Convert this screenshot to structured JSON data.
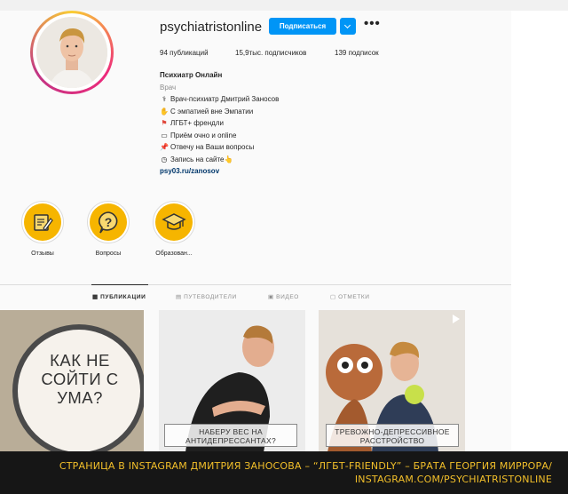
{
  "profile": {
    "username": "psychiatristonline",
    "follow_label": "Подписаться",
    "more_label": "•••",
    "stats": {
      "posts": "94 публикаций",
      "followers": "15,9тыс. подписчиков",
      "following": "139 подписок"
    },
    "bio": {
      "name": "Психиатр Онлайн",
      "category": "Врач",
      "lines": [
        {
          "icon": "doctor-icon",
          "glyph": "⚕",
          "text": "Врач-психиатр Дмитрий Заносов"
        },
        {
          "icon": "hands-icon",
          "glyph": "✋",
          "text": "С эмпатией вне Эмпатии"
        },
        {
          "icon": "rainbow-flag-icon",
          "glyph": "⚑",
          "text": "ЛГБТ+ френдли"
        },
        {
          "icon": "laptop-icon",
          "glyph": "▭",
          "text": "Приём очно и online"
        },
        {
          "icon": "pin-icon",
          "glyph": "📌",
          "text": "Отвечу на Ваши вопросы"
        },
        {
          "icon": "clock-icon",
          "glyph": "◷",
          "text": "Запись на сайте👆"
        }
      ],
      "link": "psy03.ru/zanosov"
    }
  },
  "highlights": [
    {
      "label": "Отзывы",
      "icon": "pencil-note-icon"
    },
    {
      "label": "Вопросы",
      "icon": "question-icon"
    },
    {
      "label": "Образован...",
      "icon": "graduation-cap-icon"
    }
  ],
  "tabs": [
    {
      "label": "ПУБЛИКАЦИИ",
      "icon": "grid-icon",
      "active": true
    },
    {
      "label": "ПУТЕВОДИТЕЛИ",
      "icon": "guide-icon",
      "active": false
    },
    {
      "label": "ВИДЕО",
      "icon": "video-icon",
      "active": false
    },
    {
      "label": "ОТМЕТКИ",
      "icon": "tag-icon",
      "active": false
    }
  ],
  "posts": [
    {
      "title": "КАК НЕ СОЙТИ С УМА?"
    },
    {
      "title": "НАБЕРУ ВЕС НА АНТИДЕПРЕССАНТАХ?"
    },
    {
      "title": "ТРЕВОЖНО-ДЕПРЕССИВНОЕ РАССТРОЙСТВО"
    }
  ],
  "footer": {
    "line1": "СТРАНИЦА В INSTAGRAM ДМИТРИЯ ЗАНОСОВА – “ЛГБТ-FRIENDLY” – БРАТА ГЕОРГИЯ МИРРОРА/",
    "line2": "INSTAGRAM.COM/PSYCHIATRISTONLINE"
  },
  "colors": {
    "accent": "#0095f6",
    "highlight": "#f6b500",
    "caption": "#f2bf2a"
  }
}
